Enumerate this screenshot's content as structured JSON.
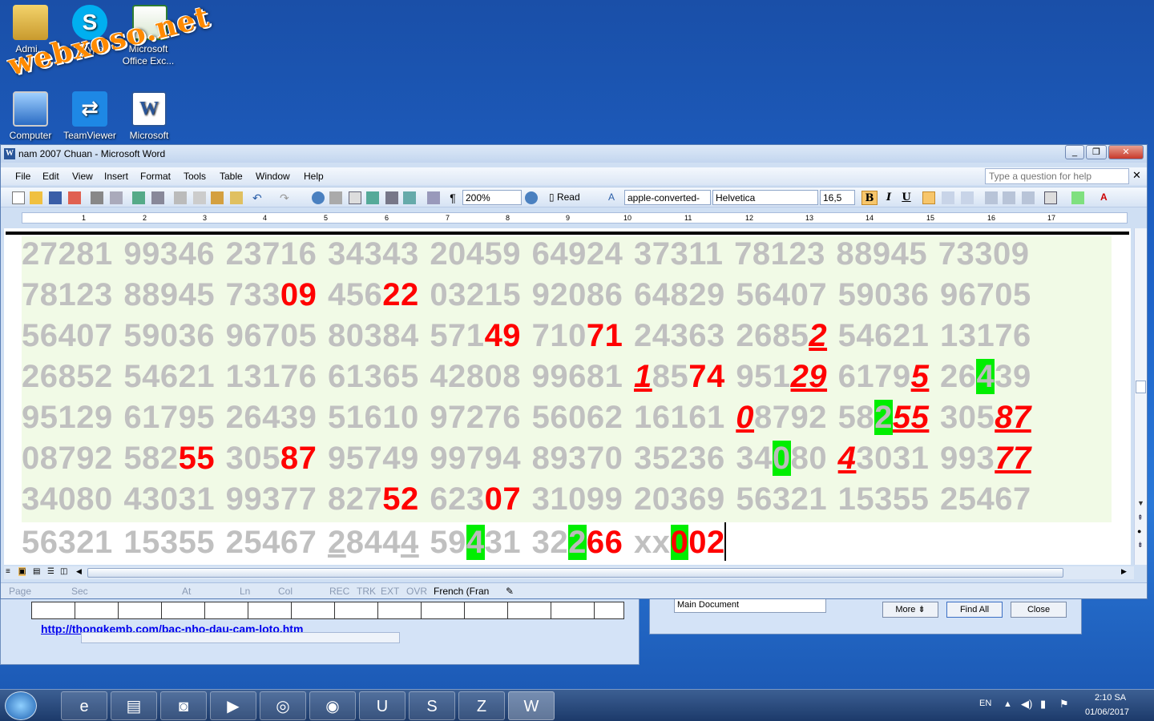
{
  "desktop": {
    "icons": [
      {
        "label": "Admi...",
        "name": "user-folder-icon"
      },
      {
        "label": "Skype",
        "name": "skype-icon"
      },
      {
        "label": "Microsoft Office Exc...",
        "name": "excel-icon"
      },
      {
        "label": "Computer",
        "name": "computer-icon"
      },
      {
        "label": "TeamViewer",
        "name": "teamviewer-icon"
      },
      {
        "label": "Microsoft",
        "name": "word-icon"
      }
    ],
    "watermark": "webxoso.net"
  },
  "window": {
    "title": "nam 2007 Chuan - Microsoft Word",
    "controls": {
      "minimize": "_",
      "restore": "❐",
      "close": "✕"
    }
  },
  "menu": [
    "File",
    "Edit",
    "View",
    "Insert",
    "Format",
    "Tools",
    "Table",
    "Window",
    "Help"
  ],
  "help_box": {
    "placeholder": "Type a question for help"
  },
  "toolbar": {
    "zoom": "200%",
    "read_label": "Read",
    "style": "apple-converted-",
    "font": "Helvetica",
    "size": "16,5",
    "bold": "B",
    "italic": "I",
    "underline": "U"
  },
  "ruler": [
    "1",
    "2",
    "3",
    "4",
    "5",
    "6",
    "7",
    "8",
    "9",
    "10",
    "11",
    "12",
    "13",
    "14",
    "15",
    "16",
    "17"
  ],
  "rows": [
    [
      [
        "27281"
      ],
      [
        "99346"
      ],
      [
        "23716"
      ],
      [
        "34343"
      ],
      [
        "20459"
      ],
      [
        "64924"
      ],
      [
        "37311"
      ],
      [
        "78123"
      ],
      [
        "88945"
      ],
      [
        "73309"
      ]
    ],
    [
      [
        "78123"
      ],
      [
        "88945"
      ],
      [
        "733",
        "09"
      ],
      [
        "456",
        "22"
      ],
      [
        "03215"
      ],
      [
        "92086"
      ],
      [
        "64829"
      ],
      [
        "56407"
      ],
      [
        "59036"
      ],
      [
        "96705"
      ]
    ],
    [
      [
        "56407"
      ],
      [
        "59036"
      ],
      [
        "96705"
      ],
      [
        "80384"
      ],
      [
        "571",
        "49"
      ],
      [
        "710",
        "71"
      ],
      [
        "24363"
      ],
      [
        "2685",
        "2"
      ],
      [
        "54621"
      ],
      [
        "13176"
      ]
    ],
    [
      [
        "26852"
      ],
      [
        "54621"
      ],
      [
        "13176"
      ],
      [
        "61365"
      ],
      [
        "42808"
      ],
      [
        "99681"
      ],
      [
        "1",
        "8",
        "5",
        "74"
      ],
      [
        "951",
        "29"
      ],
      [
        "6179",
        "5"
      ],
      [
        "26",
        "4",
        "39"
      ]
    ],
    [
      [
        "95129"
      ],
      [
        "61795"
      ],
      [
        "26439"
      ],
      [
        "51610"
      ],
      [
        "97276"
      ],
      [
        "56062"
      ],
      [
        "16161"
      ],
      [
        "0",
        "8792"
      ],
      [
        "58",
        "2",
        "55"
      ],
      [
        "305",
        "87"
      ]
    ],
    [
      [
        "08792"
      ],
      [
        "582",
        "55"
      ],
      [
        "305",
        "87"
      ],
      [
        "95749"
      ],
      [
        "99794"
      ],
      [
        "89370"
      ],
      [
        "35236"
      ],
      [
        "34",
        "0",
        "80"
      ],
      [
        "4",
        "3031"
      ],
      [
        "993",
        "77"
      ]
    ],
    [
      [
        "34080"
      ],
      [
        "43031"
      ],
      [
        "99377"
      ],
      [
        "827",
        "52"
      ],
      [
        "623",
        "07"
      ],
      [
        "31099"
      ],
      [
        "20369"
      ],
      [
        "56321"
      ],
      [
        "15355"
      ],
      [
        "25467"
      ]
    ],
    [
      [
        "56321"
      ],
      [
        "15355"
      ],
      [
        "25467"
      ],
      [
        "2",
        "844",
        "4"
      ],
      [
        "59",
        "4",
        "31"
      ],
      [
        "32",
        "2",
        "66"
      ],
      [
        "xx",
        "0",
        "02"
      ]
    ]
  ],
  "statusbar": {
    "page": "Page",
    "sec": "Sec",
    "at": "At",
    "ln": "Ln",
    "col": "Col",
    "rec": "REC",
    "trk": "TRK",
    "ext": "EXT",
    "ovr": "OVR",
    "language": "French (Fran"
  },
  "back_window": {
    "link": "http://thongkemb.com/bac-nho-dau-cam-loto.htm"
  },
  "find_dialog": {
    "search_in": "Main Document",
    "more": "More ⇟",
    "find_all": "Find All",
    "close": "Close"
  },
  "tray": {
    "lang": "EN",
    "time": "2:10 SA",
    "date": "01/06/2017"
  }
}
